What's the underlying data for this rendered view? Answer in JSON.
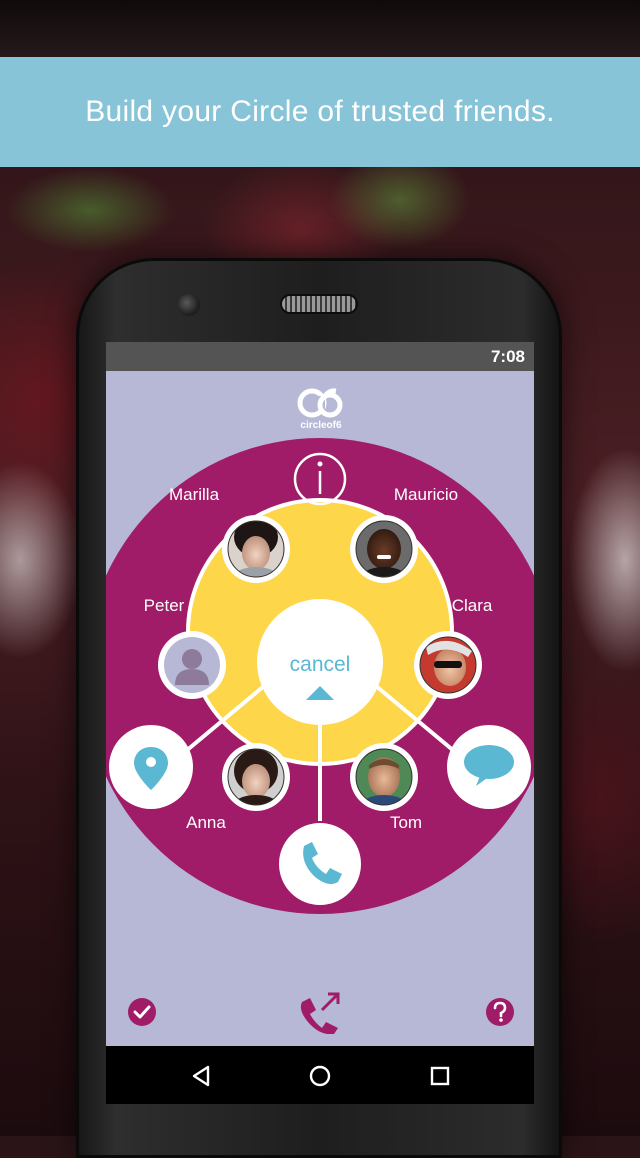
{
  "banner": {
    "text": "Build your Circle of trusted friends."
  },
  "status_bar": {
    "time": "7:08"
  },
  "app": {
    "logo_text": "circleof6",
    "center_button": {
      "label": "cancel"
    },
    "contacts": [
      {
        "name": "Marilla",
        "avatar": "photo"
      },
      {
        "name": "Mauricio",
        "avatar": "photo"
      },
      {
        "name": "Peter",
        "avatar": "default-person-icon"
      },
      {
        "name": "Clara",
        "avatar": "photo"
      },
      {
        "name": "Anna",
        "avatar": "photo"
      },
      {
        "name": "Tom",
        "avatar": "photo"
      }
    ],
    "actions": [
      "info-icon",
      "location-pin-icon",
      "chat-bubble-icon",
      "phone-icon"
    ],
    "bottom_bar": [
      "checkmark-icon",
      "outgoing-call-icon",
      "help-icon"
    ]
  },
  "nav_bar": [
    "back-icon",
    "home-icon",
    "recents-icon"
  ],
  "colors": {
    "banner": "#87c4d8",
    "app_background": "#b6b8d6",
    "magenta": "#a01c68",
    "yellow": "#fdd649",
    "accent_blue": "#5ab8d2"
  }
}
